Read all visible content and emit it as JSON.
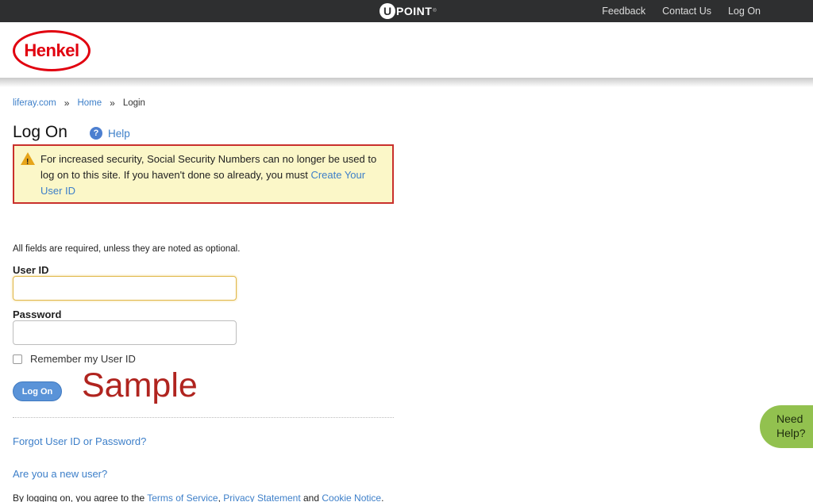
{
  "topbar": {
    "logo_u": "U",
    "logo_rest": "POINT",
    "logo_tm": "®",
    "nav": [
      "Feedback",
      "Contact Us",
      "Log On"
    ]
  },
  "header": {
    "logo_text": "Henkel"
  },
  "breadcrumb": {
    "items": [
      "liferay.com",
      "Home",
      "Login"
    ],
    "separator": "»"
  },
  "page": {
    "title": "Log On",
    "help_label": "Help",
    "help_icon": "?"
  },
  "alert": {
    "text": "For increased security, Social Security Numbers can no longer be used to log on to this site. If you haven't done so already, you must ",
    "link": "Create Your User ID",
    "icon": "!"
  },
  "form": {
    "required_note": "All fields are required, unless they are noted as optional.",
    "user_label": "User ID",
    "user_value": "",
    "password_label": "Password",
    "password_value": "",
    "remember_label": "Remember my User ID",
    "remember_checked": false,
    "submit_label": "Log On",
    "watermark": "Sample"
  },
  "links": {
    "forgot": "Forgot User ID or Password?",
    "new_user": "Are you a new user?"
  },
  "terms": {
    "prefix": "By logging on, you agree to the ",
    "tos": "Terms of Service",
    "comma": ", ",
    "privacy": "Privacy Statement",
    "and": " and ",
    "cookie": "Cookie Notice",
    "end": "."
  },
  "need_help": {
    "line1": "Need",
    "line2": "Help?"
  },
  "colors": {
    "topbar": "#2e2f30",
    "brand_red": "#e1000f",
    "link": "#3d7fc9",
    "alert_bg": "#fbf7c8",
    "alert_border": "#c9302c",
    "button": "#5a93d8",
    "need_help": "#92c14f"
  }
}
